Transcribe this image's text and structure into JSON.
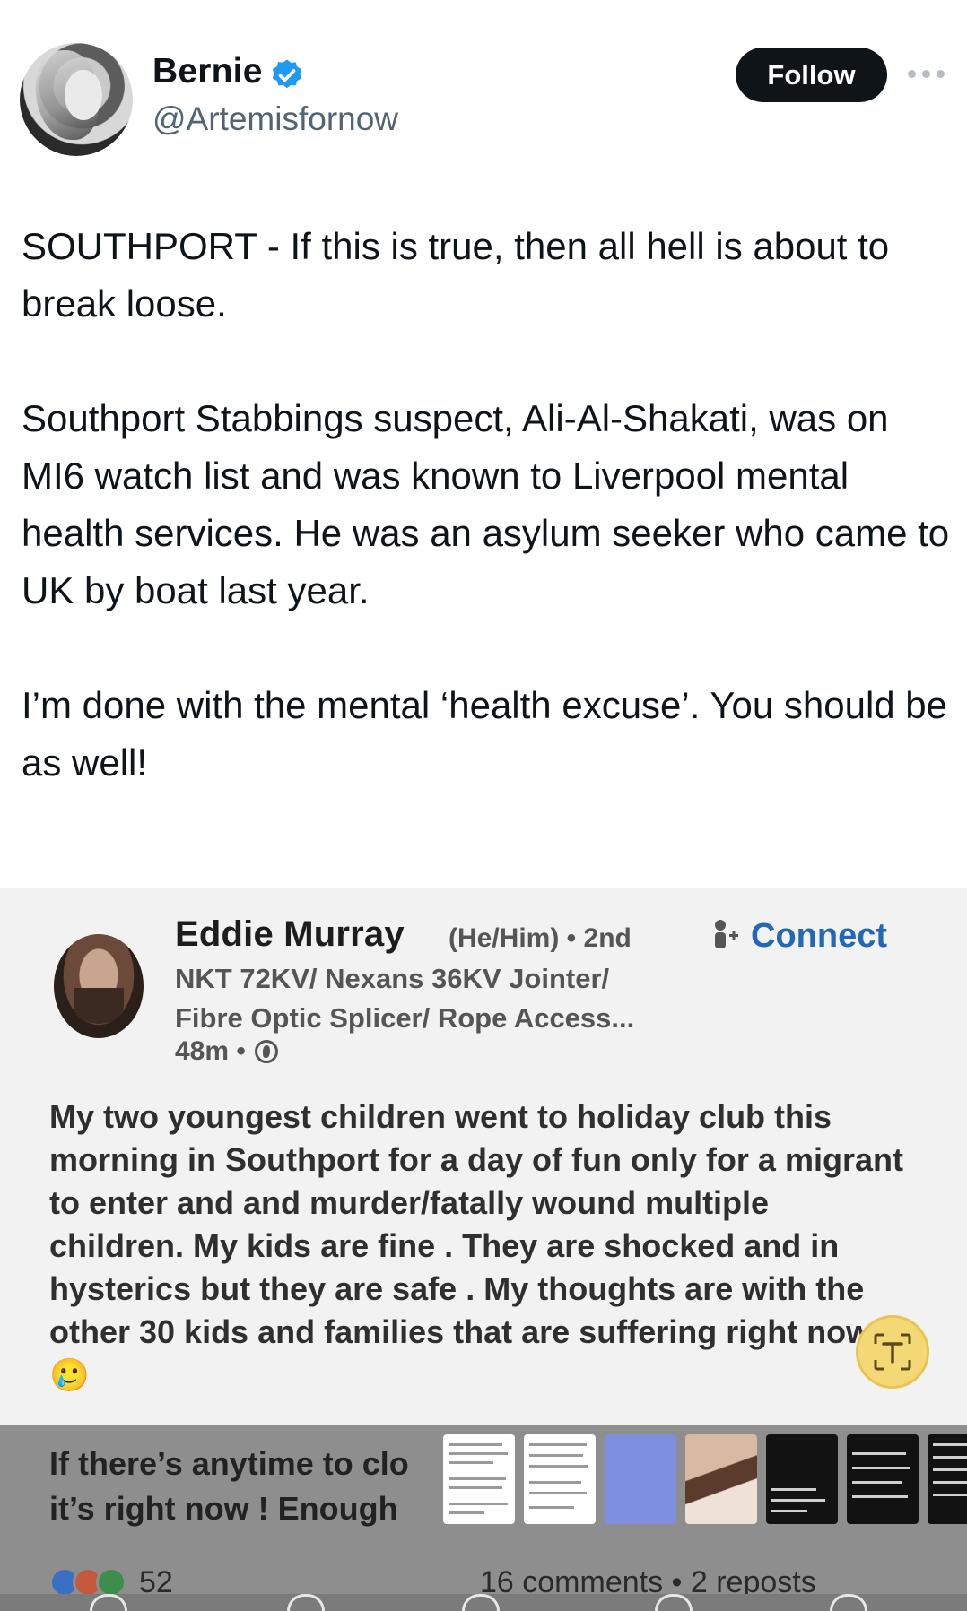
{
  "author": {
    "name": "Bernie",
    "handle": "@Artemisfornow",
    "verified": true,
    "follow_label": "Follow"
  },
  "tweet": {
    "paragraphs": [
      "SOUTHPORT - If this is true, then all hell is about to break loose.",
      "Southport Stabbings suspect, Ali-Al-Shakati, was on MI6 watch list and was known to Liverpool mental health services. He was an asylum seeker  who came  to UK by boat last year.",
      "I’m done with the mental ‘health excuse’. You should be as well!"
    ]
  },
  "embedded_post": {
    "name": "Eddie Murray",
    "pronoun_degree": "(He/Him) • 2nd",
    "connect_label": "Connect",
    "headline_1": "NKT 72KV/ Nexans 36KV Jointer/",
    "headline_2": "Fibre Optic Splicer/ Rope Access...",
    "time": "48m •",
    "body": "My two youngest children went to holiday club this morning in Southport  for a day of fun only for a migrant to enter and and murder/fatally wound multiple children. My kids are fine . They are shocked and in hysterics but they are safe . My thoughts are with the other 30 kids and families that are suffering right now 🥲",
    "overlay_line_1": "If there’s anytime to clo",
    "overlay_line_2": "it’s right now !  Enough",
    "reaction_count": "52",
    "comments_reposts": "16 comments  •  2 reposts"
  },
  "icons": {
    "verified": "verified-badge-icon",
    "more": "more-options-icon",
    "connect": "add-person-icon",
    "globe": "globe-icon",
    "translate": "text-recognition-icon"
  },
  "colors": {
    "follow_bg": "#0f1419",
    "verified_blue": "#1d9bf0",
    "connect_blue": "#2367b5",
    "translate_yellow": "#f4d876"
  }
}
